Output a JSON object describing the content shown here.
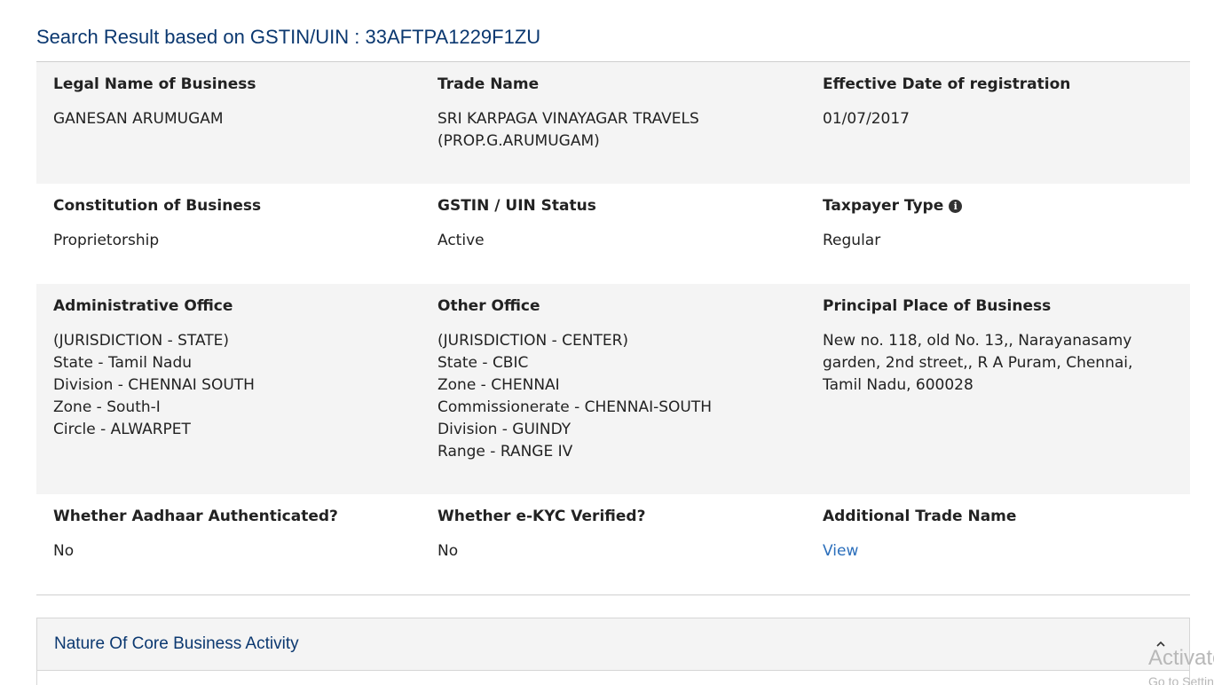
{
  "header": {
    "title": "Search Result based on GSTIN/UIN : 33AFTPA1229F1ZU"
  },
  "details": {
    "legal_name": {
      "label": "Legal Name of Business",
      "value": "GANESAN ARUMUGAM"
    },
    "trade_name": {
      "label": "Trade Name",
      "value": "SRI KARPAGA VINAYAGAR TRAVELS (PROP.G.ARUMUGAM)"
    },
    "effective_date": {
      "label": "Effective Date of registration",
      "value": "01/07/2017"
    },
    "constitution": {
      "label": "Constitution of Business",
      "value": "Proprietorship"
    },
    "status": {
      "label": "GSTIN / UIN Status",
      "value": "Active"
    },
    "taxpayer_type": {
      "label": "Taxpayer Type",
      "value": "Regular",
      "icon": "info-circle-icon"
    },
    "administrative_office": {
      "label": "Administrative Office",
      "lines": [
        "(JURISDICTION - STATE)",
        "State - Tamil Nadu",
        "Division - CHENNAI SOUTH",
        "Zone - South-I",
        "Circle - ALWARPET"
      ]
    },
    "other_office": {
      "label": "Other Office",
      "lines": [
        "(JURISDICTION - CENTER)",
        "State - CBIC",
        "Zone - CHENNAI",
        "Commissionerate - CHENNAI-SOUTH",
        "Division - GUINDY",
        "Range - RANGE IV"
      ]
    },
    "principal_place": {
      "label": "Principal Place of Business",
      "value": "New no. 118, old No. 13,, Narayanasamy garden, 2nd street,, R A Puram, Chennai, Tamil Nadu, 600028"
    },
    "aadhaar": {
      "label": "Whether Aadhaar Authenticated?",
      "value": "No"
    },
    "ekyc": {
      "label": "Whether e-KYC Verified?",
      "value": "No"
    },
    "additional_trade_name": {
      "label": "Additional Trade Name",
      "link": "View"
    }
  },
  "accordion": {
    "title": "Nature Of Core Business Activity",
    "icon": "chevron-up-icon",
    "expanded": true
  },
  "overlay": {
    "watermark": "Activate Windows",
    "watermark_sub": "Go to Settings to activate Windows."
  },
  "colors": {
    "title": "#0b3870",
    "link": "#2a6ebb",
    "shaded_row": "#f4f4f4"
  }
}
